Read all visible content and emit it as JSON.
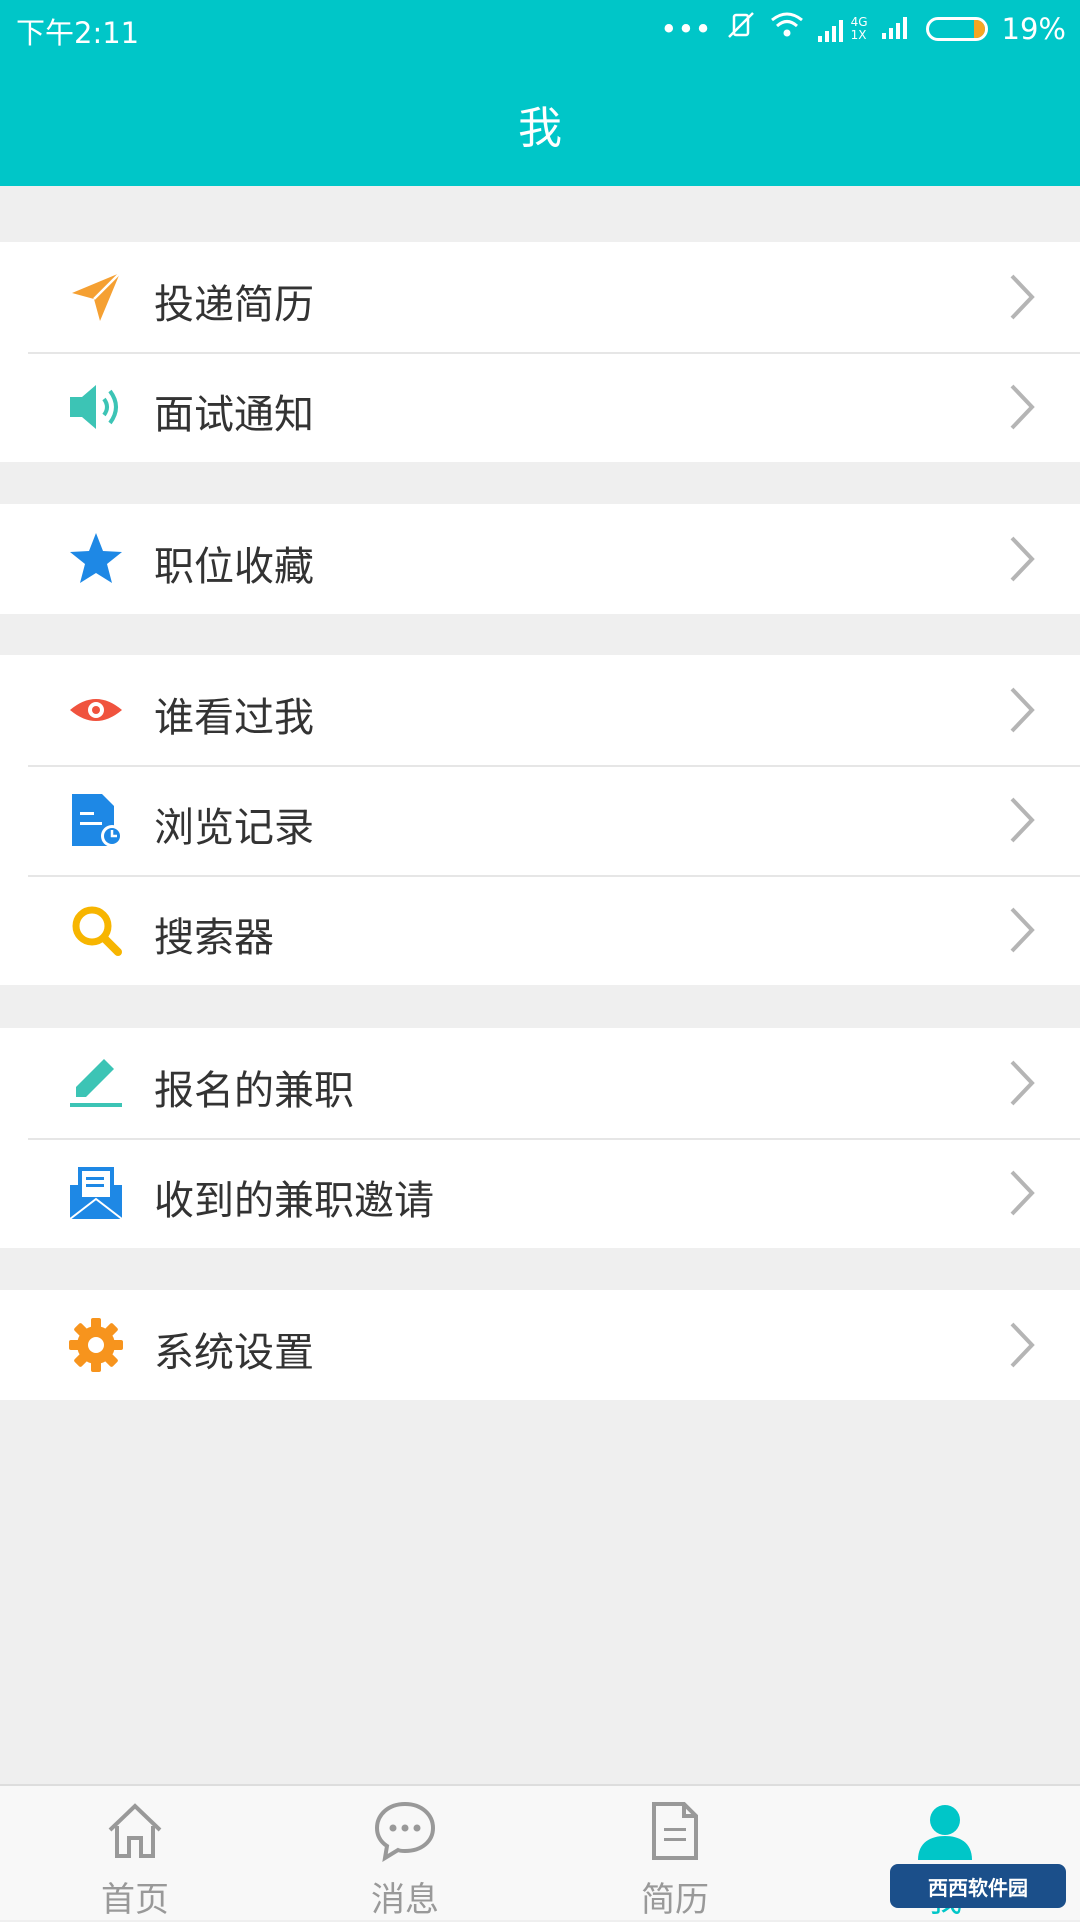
{
  "status_bar": {
    "time": "下午2:11",
    "network_4g": "4G",
    "network_1x": "1X",
    "battery": "19%",
    "battery_level": 0.19
  },
  "header": {
    "title": "我"
  },
  "groups": [
    {
      "items": [
        {
          "label": "投递简历",
          "icon": "send-resume-icon",
          "color": "#f5a032"
        },
        {
          "label": "面试通知",
          "icon": "speaker-icon",
          "color": "#3cc4b5"
        }
      ]
    },
    {
      "items": [
        {
          "label": "职位收藏",
          "icon": "star-icon",
          "color": "#1e88e5"
        }
      ]
    },
    {
      "items": [
        {
          "label": "谁看过我",
          "icon": "eye-icon",
          "color": "#f0533e"
        },
        {
          "label": "浏览记录",
          "icon": "history-icon",
          "color": "#1e88e5"
        },
        {
          "label": "搜索器",
          "icon": "search-icon",
          "color": "#f7b500"
        }
      ]
    },
    {
      "items": [
        {
          "label": "报名的兼职",
          "icon": "edit-icon",
          "color": "#3cc4b5"
        },
        {
          "label": "收到的兼职邀请",
          "icon": "mail-icon",
          "color": "#1e88e5"
        }
      ]
    },
    {
      "items": [
        {
          "label": "系统设置",
          "icon": "gear-icon",
          "color": "#f7941d"
        }
      ]
    }
  ],
  "tabs": [
    {
      "label": "首页",
      "icon": "home-icon",
      "active": false
    },
    {
      "label": "消息",
      "icon": "message-icon",
      "active": false
    },
    {
      "label": "简历",
      "icon": "resume-icon",
      "active": false
    },
    {
      "label": "我",
      "icon": "user-icon",
      "active": true
    }
  ],
  "colors": {
    "accent": "#00c6c8",
    "inactive": "#999999",
    "background": "#efefef"
  },
  "watermark": {
    "text": "西西软件园"
  }
}
